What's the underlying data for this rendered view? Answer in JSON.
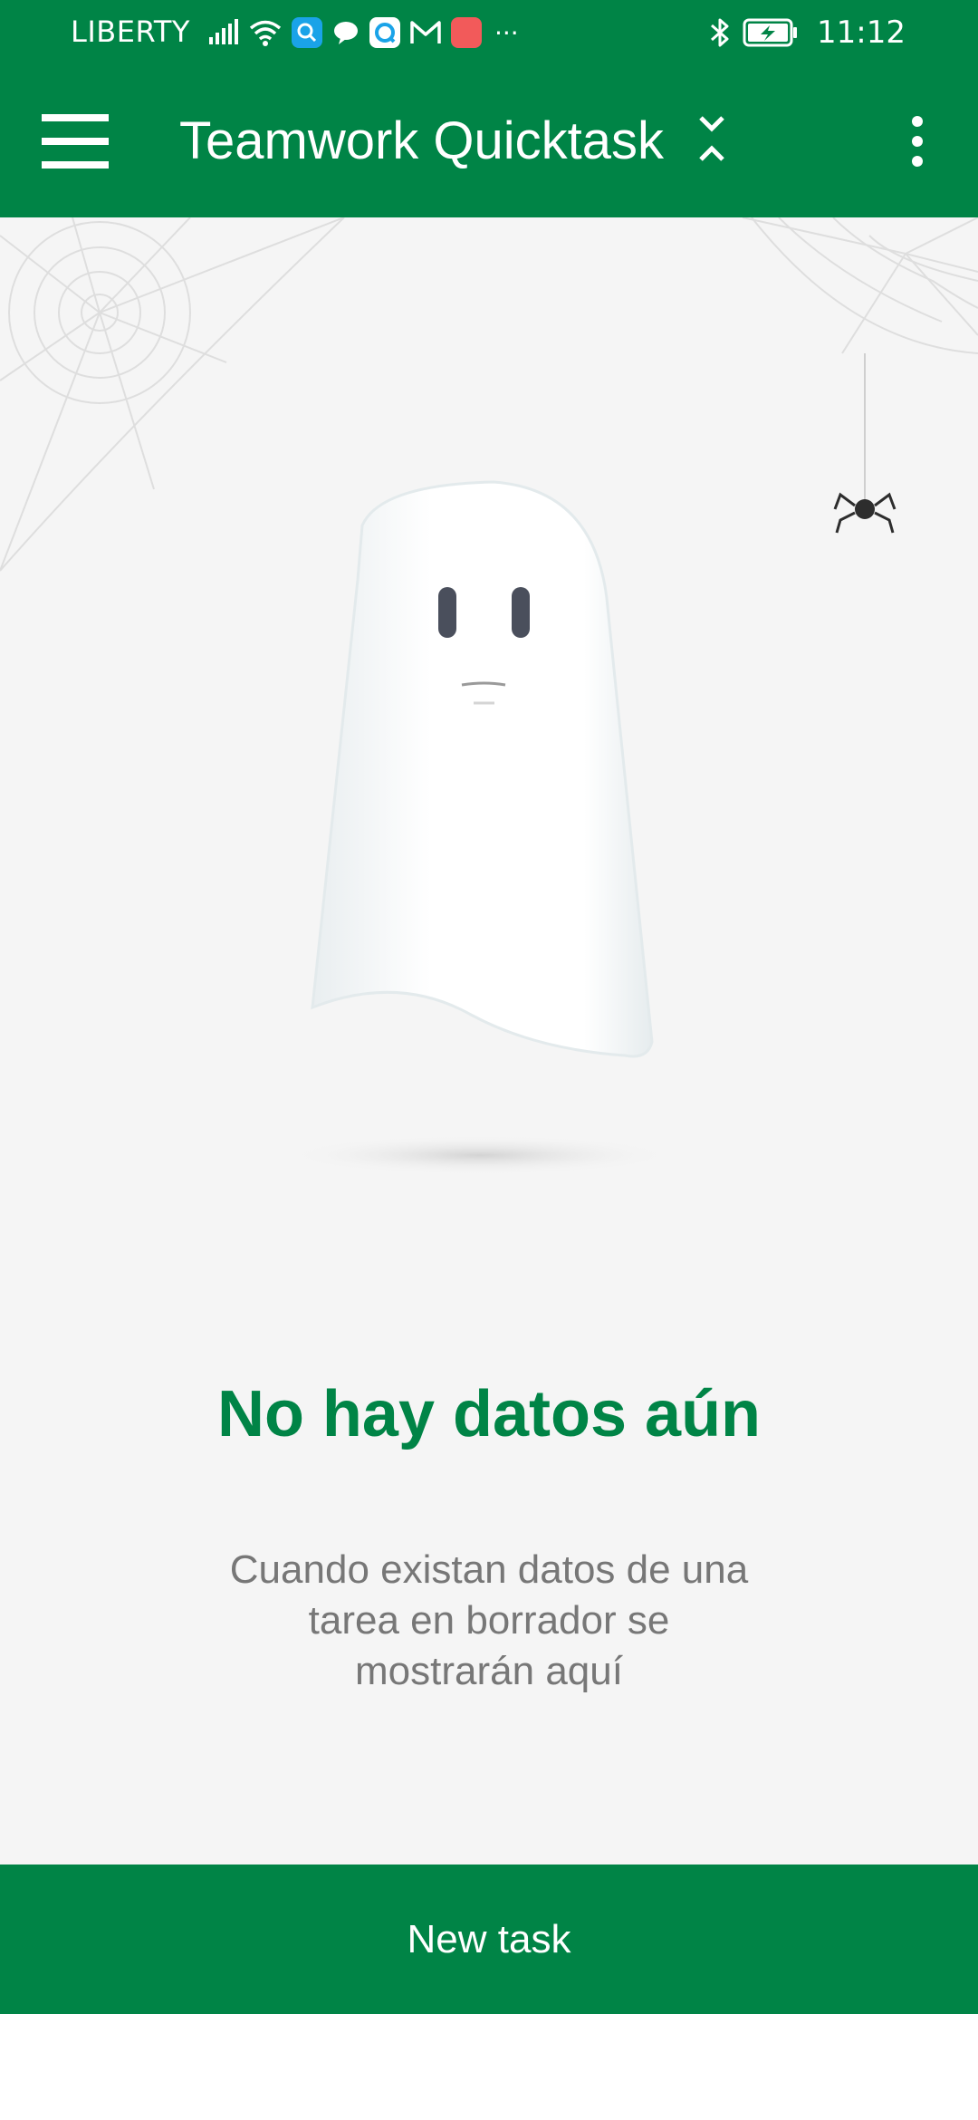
{
  "status_bar": {
    "carrier": "LIBERTY",
    "time": "11:12",
    "more": "···",
    "left_icons": [
      "signal-icon",
      "wifi-icon",
      "search-app-icon",
      "chat-bubble-icon",
      "qq-app-icon",
      "gmail-icon",
      "huawei-app-icon"
    ],
    "right_icons": [
      "bluetooth-icon",
      "battery-charging-icon"
    ]
  },
  "app_bar": {
    "title": "Teamwork Quicktask",
    "menu_icon": "hamburger-menu-icon",
    "more_icon": "more-vertical-icon",
    "title_icon": "collapse-chevrons-icon"
  },
  "empty_state": {
    "title": "No hay datos aún",
    "description": "Cuando existan datos de una tarea en borrador se mostrarán aquí",
    "illustration": "ghost-with-cobwebs-and-spider"
  },
  "footer": {
    "button_label": "New task"
  },
  "colors": {
    "primary": "#008446",
    "background": "#f5f5f5",
    "text_secondary": "#777777"
  }
}
